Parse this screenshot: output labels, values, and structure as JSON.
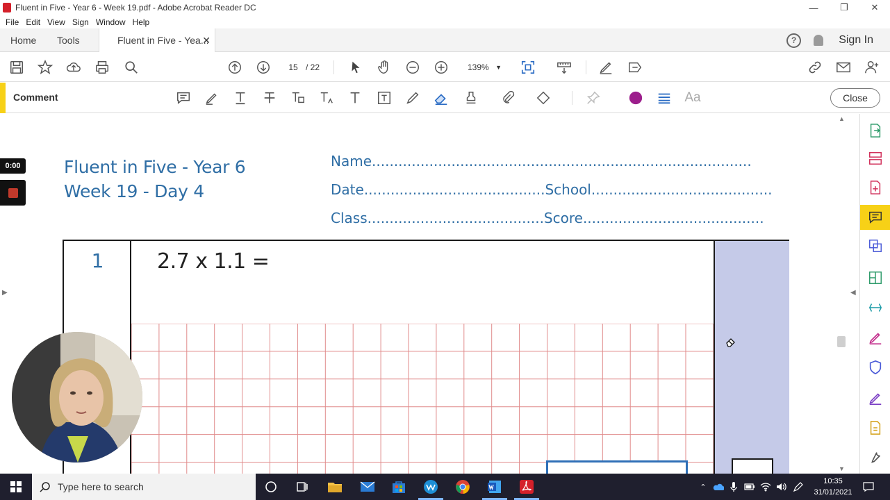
{
  "window": {
    "title": "Fluent in Five - Year 6 - Week 19.pdf - Adobe Acrobat Reader DC",
    "controls": [
      "minimize",
      "restore",
      "close"
    ]
  },
  "menubar": {
    "items": [
      "File",
      "Edit",
      "View",
      "Sign",
      "Window",
      "Help"
    ]
  },
  "tabs": {
    "home": "Home",
    "tools": "Tools",
    "document": "Fluent in Five - Yea...",
    "sign_in": "Sign In",
    "help_symbol": "?"
  },
  "toolbar": {
    "page_current": "15",
    "page_separator": "/ 22",
    "zoom": "139%",
    "icons": [
      "save-icon",
      "star-icon",
      "upload-icon",
      "print-icon",
      "search-icon",
      "page-up-icon",
      "page-down-icon",
      "select-arrow-icon",
      "hand-icon",
      "zoom-out-icon",
      "zoom-in-icon",
      "fit-page-icon",
      "ruler-icon",
      "sign-icon",
      "share-icon",
      "link-icon",
      "mail-icon",
      "add-user-icon"
    ]
  },
  "comment_toolbar": {
    "label": "Comment",
    "close_label": "Close",
    "accent_color": "#f7d117",
    "color_swatch": "#9c1e8c",
    "text_style": "Aa"
  },
  "document": {
    "heading_line1": "Fluent in Five - Year 6",
    "heading_line2": "Week 19 - Day 4",
    "name_label": "Name",
    "date_label": "Date",
    "school_label": "School",
    "class_label": "Class",
    "score_label": "Score",
    "question_number": "1",
    "question_text": "2.7 x 1.1 =",
    "heading_color": "#2f6ea5",
    "score_column_color": "#c5cae8",
    "grid_color": "#e08a8a"
  },
  "recorder": {
    "time": "0:00"
  },
  "taskbar": {
    "search_placeholder": "Type here to search",
    "time": "10:35",
    "date": "31/01/2021",
    "apps": [
      "cortana-icon",
      "task-view-icon",
      "file-explorer-icon",
      "mail-icon",
      "store-icon",
      "webex-icon",
      "chrome-icon",
      "word-icon",
      "acrobat-icon"
    ]
  }
}
